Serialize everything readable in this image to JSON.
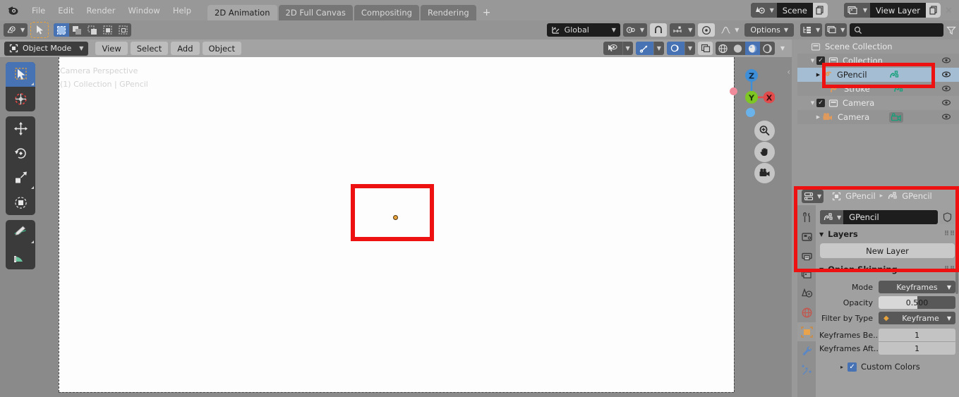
{
  "topbar": {
    "logo_icon": "blender-logo-icon",
    "menus": [
      "File",
      "Edit",
      "Render",
      "Window",
      "Help"
    ],
    "workspace_tabs": [
      {
        "label": "2D Animation",
        "active": true
      },
      {
        "label": "2D Full Canvas",
        "active": false
      },
      {
        "label": "Compositing",
        "active": false
      },
      {
        "label": "Rendering",
        "active": false
      }
    ],
    "add_workspace_label": "+",
    "scene": {
      "name": "Scene",
      "icon": "scene-icon",
      "copy_icon": "new-scene-icon",
      "close_icon": "x-icon"
    },
    "view_layer": {
      "name": "View Layer",
      "icon": "view-layer-icon",
      "copy_icon": "new-layer-icon",
      "close_icon": "x-icon"
    }
  },
  "toolbar2": {
    "editor_type_icon": "editor-type-icon",
    "cursor_tool_icon": "cursor-arrow-icon",
    "select_modes": [
      "select-box-icon",
      "select-extend-icon",
      "select-subtract-icon",
      "select-invert-icon",
      "select-intersect-icon"
    ],
    "orientation": {
      "label": "Global",
      "icon": "orientation-icon"
    },
    "pivot_icon": "pivot-point-icon",
    "snap_magnet_icon": "magnet-icon",
    "snap_target_icon": "snap-increment-icon",
    "proportional_icon": "proportional-edit-icon",
    "falloff_icon": "smooth-falloff-icon",
    "options_label": "Options"
  },
  "outliner_header": {
    "display_mode_icon": "outliner-display-icon",
    "filter_id_icon": "view-layer-icon",
    "search_icon": "search-icon",
    "search_value": "",
    "search_placeholder": "",
    "filter_icon": "filter-icon"
  },
  "viewport_header": {
    "mode": "Object Mode",
    "mode_icon": "object-mode-icon",
    "menus": [
      "View",
      "Select",
      "Add",
      "Object"
    ],
    "visibility_icon": "visibility-eye-icon",
    "gizmo_icon": "gizmo-icon",
    "overlays_icon": "overlays-icon",
    "xray_icon": "xray-icon",
    "shading_modes": [
      "wireframe-icon",
      "solid-icon",
      "material-preview-icon",
      "rendered-icon"
    ],
    "shading_active_index": 2
  },
  "toolshelf": {
    "tools": [
      {
        "icon": "tweak-select-box-icon",
        "name": "select-box-tool",
        "active": true
      },
      {
        "icon": "cursor-3d-icon",
        "name": "cursor-tool",
        "active": false
      },
      {
        "icon": "move-icon",
        "name": "move-tool",
        "active": false
      },
      {
        "icon": "rotate-icon",
        "name": "rotate-tool",
        "active": false
      },
      {
        "icon": "scale-icon",
        "name": "scale-tool",
        "active": false
      },
      {
        "icon": "transform-icon",
        "name": "transform-tool",
        "active": false
      },
      {
        "icon": "annotate-pencil-icon",
        "name": "annotate-tool",
        "active": false
      },
      {
        "icon": "measure-ruler-icon",
        "name": "measure-tool",
        "active": false
      }
    ]
  },
  "viewport": {
    "info_line_1": "Camera Perspective",
    "info_line_2": "(1) Collection | GPencil",
    "gizmo_axes": [
      {
        "label": "Z",
        "color": "#3f8fd8"
      },
      {
        "label": "Y",
        "color": "#7dc623"
      },
      {
        "label": "X",
        "color": "#e14b4b"
      }
    ],
    "nav_buttons": [
      "zoom-icon",
      "pan-hand-icon",
      "camera-view-icon"
    ],
    "annotation_color": "#ee1111",
    "collapse_icon": "chevron-left-icon"
  },
  "outliner": {
    "rows": [
      {
        "label": "Scene Collection",
        "icon": "collection-icon",
        "indent": 0,
        "disclosure": "",
        "selected": false,
        "checkbox": null,
        "eye": true,
        "alt": false
      },
      {
        "label": "Collection",
        "icon": "collection-icon",
        "indent": 1,
        "disclosure": "down",
        "selected": false,
        "checkbox": "checked",
        "eye": true,
        "alt": true
      },
      {
        "label": "GPencil",
        "icon": "gpencil-object-icon",
        "indent": 2,
        "disclosure": "right",
        "selected": true,
        "checkbox": null,
        "eye": true,
        "alt": false,
        "data_icon": "gpencil-data-icon"
      },
      {
        "label": "Stroke",
        "icon": "gpencil-object-icon",
        "indent": 3,
        "disclosure": "",
        "selected": false,
        "checkbox": null,
        "eye": true,
        "alt": true,
        "data_icon": "gpencil-data-icon"
      },
      {
        "label": "Camera",
        "icon": "collection-icon",
        "indent": 1,
        "disclosure": "down",
        "selected": false,
        "checkbox": "checked",
        "eye": true,
        "alt": false
      },
      {
        "label": "Camera",
        "icon": "camera-object-icon",
        "indent": 2,
        "disclosure": "right",
        "selected": false,
        "checkbox": null,
        "eye": true,
        "alt": true,
        "data_icon": "camera-data-icon"
      }
    ]
  },
  "properties": {
    "editor_icon": "properties-editor-icon",
    "breadcrumb": [
      {
        "label": "GPencil",
        "icon": "object-icon"
      },
      {
        "label": "GPencil",
        "icon": "gpencil-data-icon"
      }
    ],
    "breadcrumb_sep": "▸",
    "tabs": [
      {
        "icon": "tool-icon",
        "name": "tab-tool",
        "active": false
      },
      {
        "icon": "render-camera-icon",
        "name": "tab-render",
        "active": false
      },
      {
        "icon": "output-printer-icon",
        "name": "tab-output",
        "active": false
      },
      {
        "icon": "view-layer-images-icon",
        "name": "tab-view-layer",
        "active": false
      },
      {
        "icon": "scene-cone-icon",
        "name": "tab-scene",
        "active": false
      },
      {
        "icon": "world-globe-icon",
        "name": "tab-world",
        "active": false
      },
      {
        "icon": "object-square-icon",
        "name": "tab-object",
        "active": false
      },
      {
        "icon": "modifier-wrench-icon",
        "name": "tab-modifiers",
        "active": false
      },
      {
        "icon": "effects-particles-icon",
        "name": "tab-effects",
        "active": false
      }
    ],
    "data_block": {
      "icon": "gpencil-data-icon",
      "name": "GPencil",
      "shield_icon": "fake-user-shield-icon"
    },
    "layers_panel": {
      "title": "Layers",
      "new_layer_label": "New Layer",
      "grip_icon": "grip-dots-icon"
    },
    "onion_panel": {
      "title": "Onion Skinning",
      "grip_icon": "grip-dots-icon",
      "rows": [
        {
          "label": "Mode",
          "value": "Keyframes",
          "type": "enum"
        },
        {
          "label": "Opacity",
          "value": "0.500",
          "type": "slider",
          "fill_percent": 50
        },
        {
          "label": "Filter by Type",
          "value": "Keyframe",
          "type": "enum_icon",
          "icon": "keyframe-diamond-icon"
        },
        {
          "label": "Keyframes Be..",
          "value": "1",
          "type": "number"
        },
        {
          "label": "Keyframes Aft..",
          "value": "1",
          "type": "number"
        }
      ],
      "custom_colors": {
        "label": "Custom Colors",
        "checked": true,
        "disclosure": "▸"
      }
    },
    "annotation_color": "#ee1111"
  }
}
